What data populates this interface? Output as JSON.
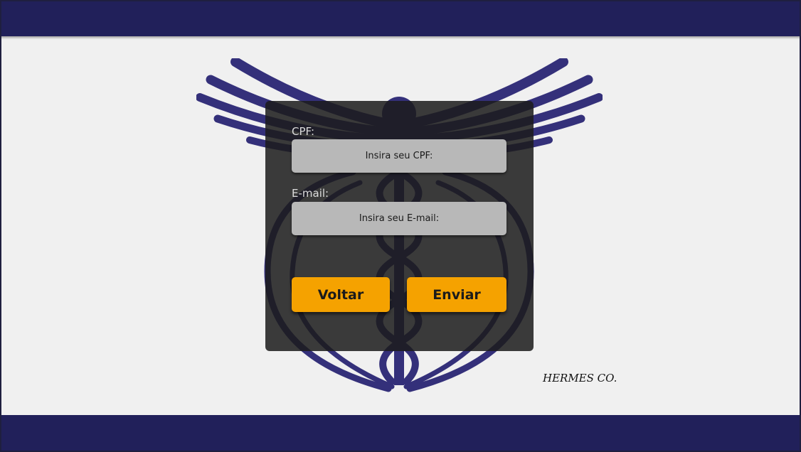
{
  "form": {
    "cpf_label": "CPF:",
    "cpf_placeholder": "Insira seu CPF:",
    "cpf_value": "",
    "email_label": "E-mail:",
    "email_placeholder": "Insira seu E-mail:",
    "email_value": ""
  },
  "buttons": {
    "back_label": "Voltar",
    "submit_label": "Enviar"
  },
  "brand": {
    "name": "HERMES CO."
  },
  "colors": {
    "header": "#21205a",
    "emblem": "#34307a",
    "panel": "#1c1c1c",
    "button": "#f5a200",
    "field": "#b8b8b8"
  },
  "icons": {
    "emblem": "caduceus-icon"
  }
}
